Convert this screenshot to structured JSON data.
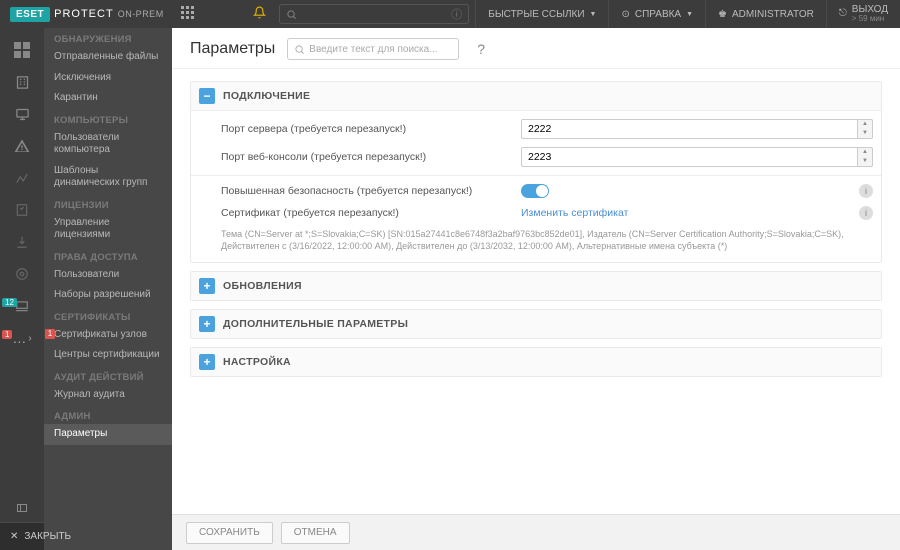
{
  "brand": {
    "eset": "ESET",
    "protect": "PROTECT",
    "onprem": "ON-PREM"
  },
  "topbar": {
    "search_placeholder": "",
    "quick": "БЫСТРЫЕ ССЫЛКИ",
    "help_icon": "⟳",
    "help": "СПРАВКА",
    "user_icon": "⛭",
    "user": "ADMINISTRATOR",
    "exit": "ВЫХОД",
    "exit_sub": "> 59 мин"
  },
  "rail": {
    "badges": {
      "computers": "12",
      "more": "1"
    },
    "close": "ЗАКРЫТЬ"
  },
  "sidebar": {
    "g_detections": "ОБНАРУЖЕНИЯ",
    "i_sent_files": "Отправленные файлы",
    "i_exclusions": "Исключения",
    "i_quarantine": "Карантин",
    "g_computers": "КОМПЬЮТЕРЫ",
    "i_comp_users": "Пользователи компьютера",
    "i_dyn_templates": "Шаблоны динамических групп",
    "g_licenses": "ЛИЦЕНЗИИ",
    "i_lic_mgmt": "Управление лицензиями",
    "g_access": "ПРАВА ДОСТУПА",
    "i_users": "Пользователи",
    "i_permsets": "Наборы разрешений",
    "g_certs": "СЕРТИФИКАТЫ",
    "i_node_certs": "Сертификаты узлов",
    "i_node_certs_badge": "1",
    "i_ca": "Центры сертификации",
    "g_audit": "АУДИТ ДЕЙСТВИЙ",
    "i_audit_log": "Журнал аудита",
    "g_admin": "АДМИН",
    "i_params": "Параметры"
  },
  "page": {
    "title": "Параметры",
    "search_placeholder": "Введите текст для поиска...",
    "help": "?"
  },
  "sections": {
    "conn": {
      "title": "ПОДКЛЮЧЕНИЕ",
      "server_port_lbl": "Порт сервера (требуется перезапуск!)",
      "server_port_val": "2222",
      "web_port_lbl": "Порт веб-консоли (требуется перезапуск!)",
      "web_port_val": "2223",
      "adv_sec_lbl": "Повышенная безопасность (требуется перезапуск!)",
      "cert_lbl": "Сертификат (требуется перезапуск!)",
      "cert_link": "Изменить сертификат",
      "cert_details": "Тема (CN=Server at *;S=Slovakia;C=SK) [SN:015a27441c8e6748f3a2baf9763bc852de01], Издатель (CN=Server Certification Authority;S=Slovakia;C=SK), Действителен с (3/16/2022, 12:00:00 AM), Действителен до (3/13/2032, 12:00:00 AM), Альтернативные имена субъекта (*)"
    },
    "updates": "ОБНОВЛЕНИЯ",
    "extra": "ДОПОЛНИТЕЛЬНЫЕ ПАРАМЕТРЫ",
    "setup": "НАСТРОЙКА"
  },
  "footer": {
    "save": "СОХРАНИТЬ",
    "cancel": "ОТМЕНА"
  }
}
